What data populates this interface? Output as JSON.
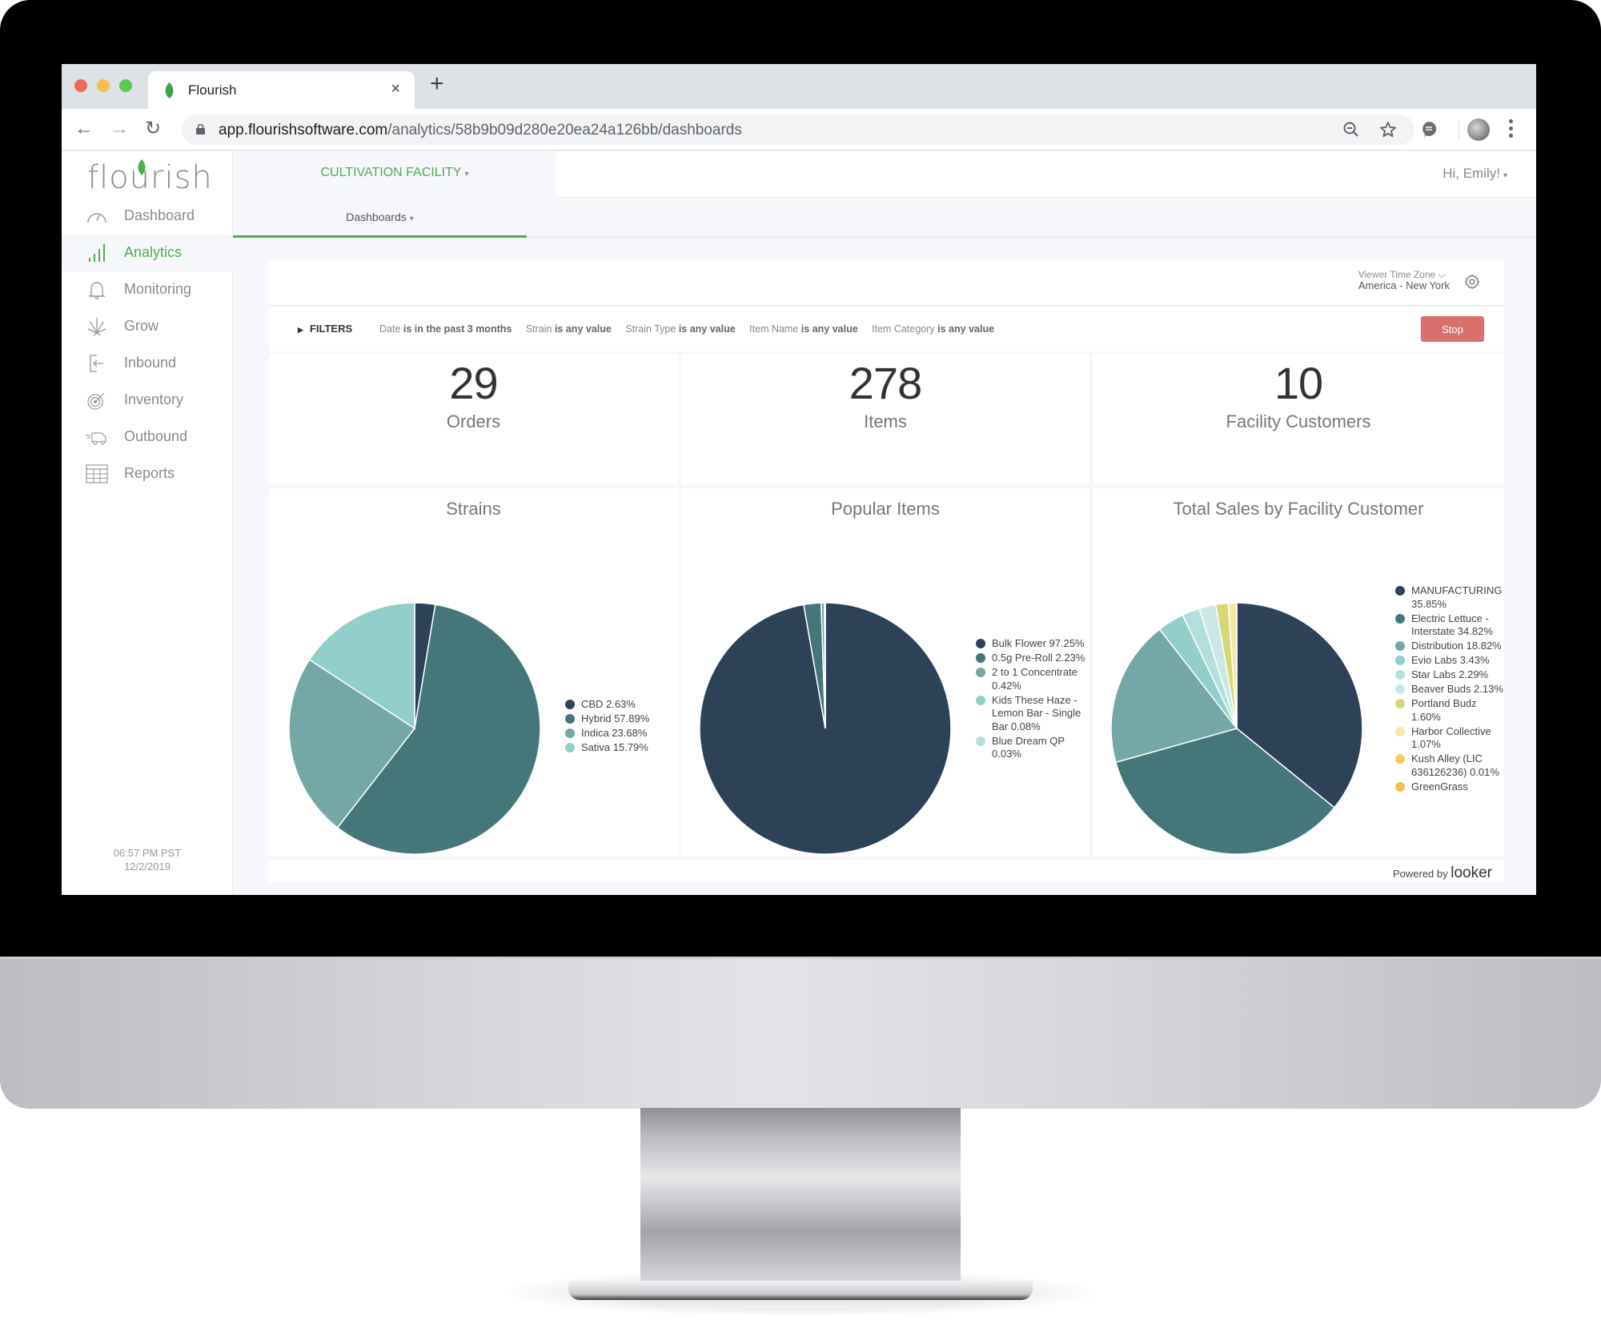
{
  "browser": {
    "tab_title": "Flourish",
    "tab_close": "×",
    "new_tab": "+",
    "url_host": "app.flourishsoftware.com",
    "url_path": "/analytics/58b9b09d280e20ea24a126bb/dashboards",
    "nav_back": "←",
    "nav_forward": "→",
    "nav_reload": "↻"
  },
  "app": {
    "logo_text": "flourish",
    "facility": "CULTIVATION FACILITY",
    "greeting": "Hi, Emily!",
    "subtab": "Dashboards",
    "caret": "▾",
    "clock_time": "06:57 PM PST",
    "clock_date": "12/2/2019"
  },
  "sidebar": {
    "items": [
      {
        "label": "Dashboard",
        "icon": "speedometer-icon",
        "active": false
      },
      {
        "label": "Analytics",
        "icon": "bar-chart-icon",
        "active": true
      },
      {
        "label": "Monitoring",
        "icon": "bell-icon",
        "active": false
      },
      {
        "label": "Grow",
        "icon": "cannabis-leaf-icon",
        "active": false
      },
      {
        "label": "Inbound",
        "icon": "inbound-arrow-icon",
        "active": false
      },
      {
        "label": "Inventory",
        "icon": "target-icon",
        "active": false
      },
      {
        "label": "Outbound",
        "icon": "delivery-truck-icon",
        "active": false
      },
      {
        "label": "Reports",
        "icon": "table-icon",
        "active": false
      }
    ]
  },
  "dashboard": {
    "timezone_label": "Viewer Time Zone ⌵",
    "timezone_value": "America - New York",
    "filters_label": "FILTERS",
    "filters": [
      {
        "field": "Date",
        "condition": "is in the past 3 months"
      },
      {
        "field": "Strain",
        "condition": "is any value"
      },
      {
        "field": "Strain Type",
        "condition": "is any value"
      },
      {
        "field": "Item Name",
        "condition": "is any value"
      },
      {
        "field": "Item Category",
        "condition": "is any value"
      }
    ],
    "stop_button": "Stop",
    "kpis": [
      {
        "value": "29",
        "label": "Orders"
      },
      {
        "value": "278",
        "label": "Items"
      },
      {
        "value": "10",
        "label": "Facility Customers"
      }
    ],
    "powered_by": "Powered by",
    "powered_brand": "looker"
  },
  "chart_data": [
    {
      "type": "pie",
      "title": "Strains",
      "legend_position": "right",
      "slices": [
        {
          "label": "CBD",
          "value": 2.63,
          "color": "#2d4157"
        },
        {
          "label": "Hybrid",
          "value": 57.89,
          "color": "#45777a"
        },
        {
          "label": "Indica",
          "value": 23.68,
          "color": "#74a7a5"
        },
        {
          "label": "Sativa",
          "value": 15.79,
          "color": "#92ceca"
        }
      ],
      "legend": [
        "CBD 2.63%",
        "Hybrid 57.89%",
        "Indica 23.68%",
        "Sativa 15.79%"
      ]
    },
    {
      "type": "pie",
      "title": "Popular Items",
      "legend_position": "right",
      "slices": [
        {
          "label": "Bulk Flower",
          "value": 97.25,
          "color": "#2d4157"
        },
        {
          "label": "0.5g Pre-Roll",
          "value": 2.23,
          "color": "#45777a"
        },
        {
          "label": "2 to 1 Concentrate",
          "value": 0.42,
          "color": "#74a7a5"
        },
        {
          "label": "Kids These Haze - Lemon Bar - Single Bar",
          "value": 0.08,
          "color": "#92ceca"
        },
        {
          "label": "Blue Dream QP",
          "value": 0.03,
          "color": "#b3e0dd"
        }
      ],
      "legend": [
        "Bulk Flower 97.25%",
        "0.5g Pre-Roll 2.23%",
        "2 to 1 Concentrate 0.42%",
        "Kids These Haze - Lemon Bar - Single Bar 0.08%",
        "Blue Dream QP 0.03%"
      ]
    },
    {
      "type": "pie",
      "title": "Total Sales by Facility Customer",
      "legend_position": "right",
      "slices": [
        {
          "label": "MANUFACTURING",
          "value": 35.85,
          "color": "#2d4157"
        },
        {
          "label": "Electric Lettuce - Interstate",
          "value": 34.82,
          "color": "#45777a"
        },
        {
          "label": "Distribution",
          "value": 18.82,
          "color": "#74a7a5"
        },
        {
          "label": "Evio Labs",
          "value": 3.43,
          "color": "#92ceca"
        },
        {
          "label": "Star Labs",
          "value": 2.29,
          "color": "#b3e0dd"
        },
        {
          "label": "Beaver Buds",
          "value": 2.13,
          "color": "#c9e8e6"
        },
        {
          "label": "Portland Budz",
          "value": 1.6,
          "color": "#d6d878"
        },
        {
          "label": "Harbor Collective",
          "value": 1.07,
          "color": "#f7e7a0"
        },
        {
          "label": "Kush Alley (LIC 636126236)",
          "value": 0.01,
          "color": "#f4cf5c"
        },
        {
          "label": "GreenGrass",
          "value": null,
          "color": "#f2c14e"
        }
      ],
      "legend": [
        "MANUFACTURING 35.85%",
        "Electric Lettuce - Interstate 34.82%",
        "Distribution 18.82%",
        "Evio Labs 3.43%",
        "Star Labs 2.29%",
        "Beaver Buds 2.13%",
        "Portland Budz 1.60%",
        "Harbor Collective 1.07%",
        "Kush Alley (LIC 636126236) 0.01%",
        "GreenGrass"
      ]
    }
  ]
}
